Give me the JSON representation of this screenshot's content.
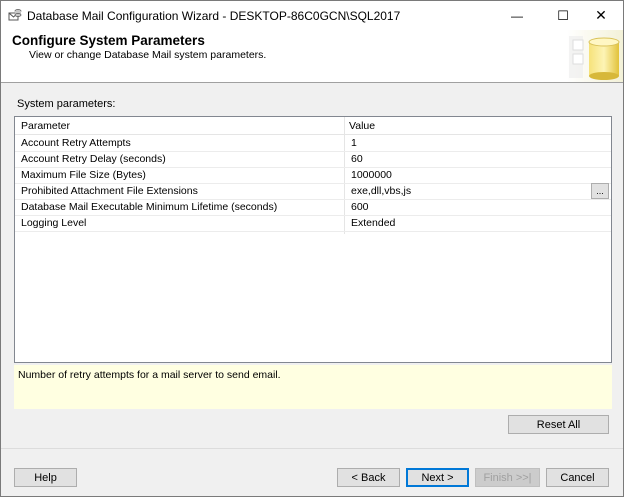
{
  "window": {
    "title": "Database Mail Configuration Wizard - DESKTOP-86C0GCN\\SQL2017",
    "controls": {
      "minimize": "—",
      "maximize": "☐",
      "close": "✕"
    }
  },
  "banner": {
    "title": "Configure System Parameters",
    "subtitle": "View or change Database Mail system parameters."
  },
  "section_label": "System parameters:",
  "grid": {
    "headers": {
      "parameter": "Parameter",
      "value": "Value"
    },
    "rows": [
      {
        "parameter": "Account Retry Attempts",
        "value": "1"
      },
      {
        "parameter": "Account Retry Delay (seconds)",
        "value": "60"
      },
      {
        "parameter": "Maximum File Size (Bytes)",
        "value": "1000000"
      },
      {
        "parameter": "Prohibited Attachment File Extensions",
        "value": "exe,dll,vbs,js",
        "button": "..."
      },
      {
        "parameter": "Database Mail Executable Minimum Lifetime (seconds)",
        "value": "600"
      },
      {
        "parameter": "Logging Level",
        "value": "Extended"
      }
    ]
  },
  "description": "Number of retry attempts for a mail server to send email.",
  "buttons": {
    "reset_all": "Reset All",
    "help": "Help",
    "back": "< Back",
    "next": "Next >",
    "finish": "Finish >>|",
    "cancel": "Cancel"
  },
  "colors": {
    "description_bg": "#ffffe1",
    "default_button_border": "#0078d7"
  }
}
